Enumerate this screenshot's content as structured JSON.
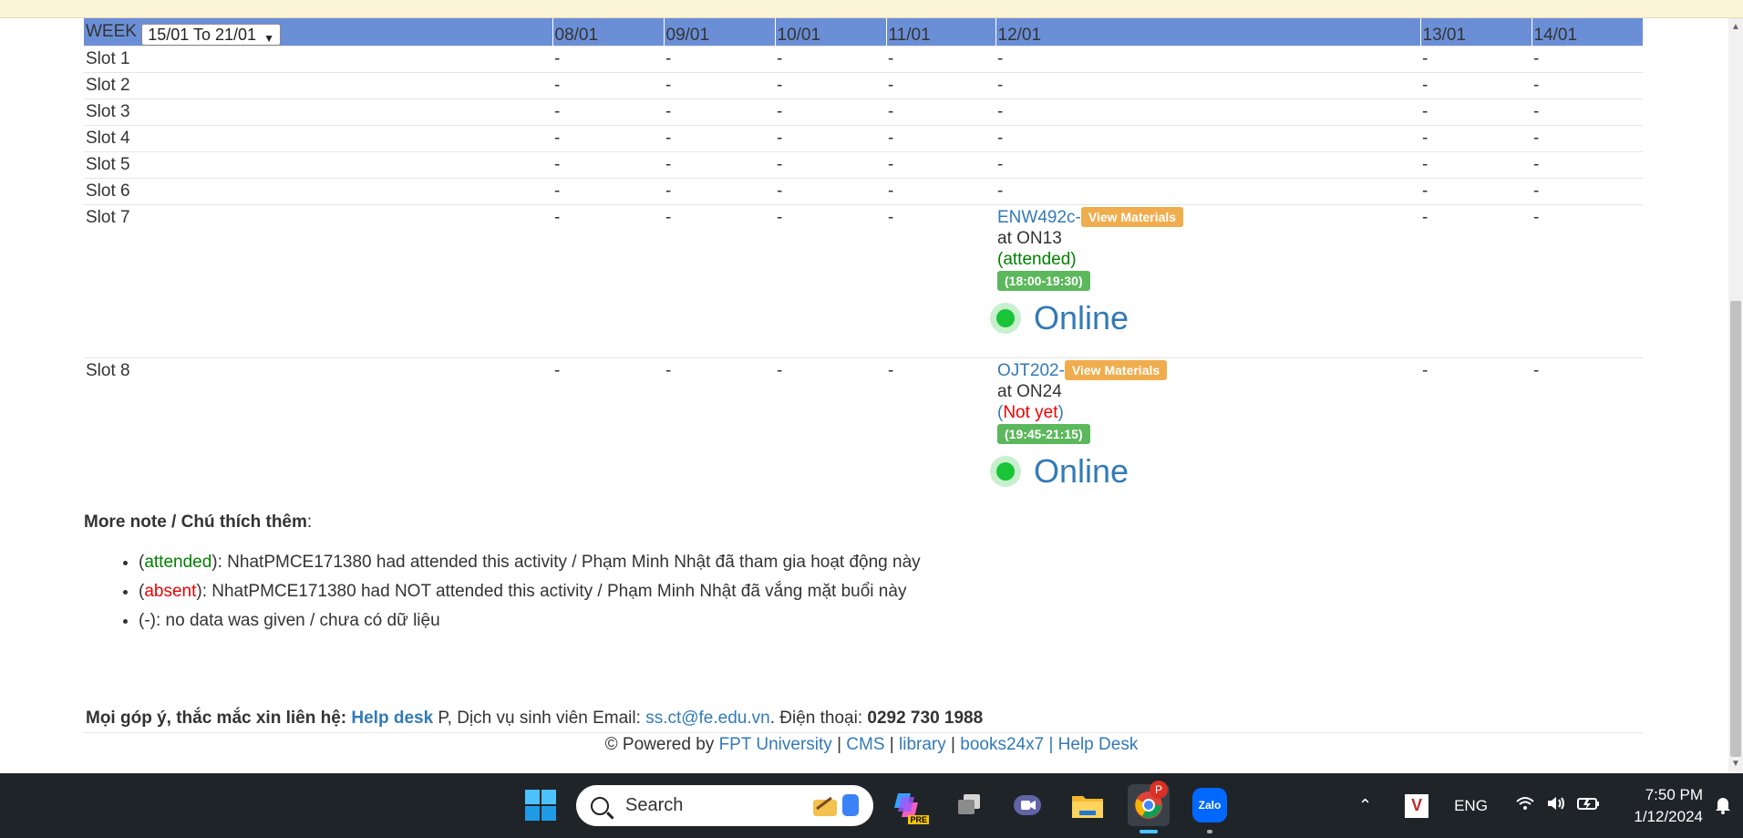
{
  "week": {
    "label": "WEEK",
    "selected": "15/01 To 21/01",
    "days": [
      "08/01",
      "09/01",
      "10/01",
      "11/01",
      "12/01",
      "13/01",
      "14/01"
    ]
  },
  "slots": [
    {
      "name": "Slot 1",
      "cells": [
        "-",
        "-",
        "-",
        "-",
        "-",
        "-",
        "-"
      ]
    },
    {
      "name": "Slot 2",
      "cells": [
        "-",
        "-",
        "-",
        "-",
        "-",
        "-",
        "-"
      ]
    },
    {
      "name": "Slot 3",
      "cells": [
        "-",
        "-",
        "-",
        "-",
        "-",
        "-",
        "-"
      ]
    },
    {
      "name": "Slot 4",
      "cells": [
        "-",
        "-",
        "-",
        "-",
        "-",
        "-",
        "-"
      ]
    },
    {
      "name": "Slot 5",
      "cells": [
        "-",
        "-",
        "-",
        "-",
        "-",
        "-",
        "-"
      ]
    },
    {
      "name": "Slot 6",
      "cells": [
        "-",
        "-",
        "-",
        "-",
        "-",
        "-",
        "-"
      ]
    },
    {
      "name": "Slot 7",
      "cells": [
        "-",
        "-",
        "-",
        "-",
        "",
        "-",
        "-"
      ]
    },
    {
      "name": "Slot 8",
      "cells": [
        "-",
        "-",
        "-",
        "-",
        "",
        "-",
        "-"
      ]
    }
  ],
  "activities": {
    "slot7": {
      "course": "ENW492c-",
      "materials": "View Materials",
      "room": "at ON13",
      "status_open": "(",
      "status": "attended",
      "status_close": ")",
      "time": "(18:00-19:30)",
      "mode": "Online"
    },
    "slot8": {
      "course": "OJT202-",
      "materials": "View Materials",
      "room": "at ON24",
      "status_open": "(",
      "status": "Not yet",
      "status_close": ")",
      "time": "(19:45-21:15)",
      "mode": "Online"
    }
  },
  "notes": {
    "title": "More note / Chú thích thêm",
    "colon": ":",
    "items": [
      {
        "open": "(",
        "key": "attended",
        "close": ")",
        "text": ": NhatPMCE171380 had attended this activity / Phạm Minh Nhật đã tham gia hoạt động này"
      },
      {
        "open": "(",
        "key": "absent",
        "close": ")",
        "text": ": NhatPMCE171380 had NOT attended this activity / Phạm Minh Nhật đã vắng mặt buổi này"
      },
      {
        "open": "",
        "key": "(-)",
        "close": "",
        "text": ": no data was given / chưa có dữ liệu"
      }
    ]
  },
  "contact": {
    "prefix": "Mọi góp ý, thắc mắc xin liên hệ: ",
    "helpdesk": "Help desk",
    "mid": " P, Dịch vụ sinh viên Email: ",
    "email": "ss.ct@fe.edu.vn",
    "phone_label": ". Điện thoại: ",
    "phone": "0292 730 1988"
  },
  "footer": {
    "powered": "© Powered by ",
    "fpt": "FPT University",
    "sep1": " | ",
    "cms": "CMS",
    "sep2": " | ",
    "library": "library",
    "sep3": " | ",
    "books": "books24x7",
    "sep4": " | ",
    "helpdesk": "Help Desk"
  },
  "taskbar": {
    "search_placeholder": "Search",
    "language": "ENG",
    "time": "7:50 PM",
    "date": "1/12/2024",
    "chrome_badge": "P",
    "zalo_label": "Zalo",
    "copilot_badge": "PRE",
    "accent": "#1f2429"
  }
}
